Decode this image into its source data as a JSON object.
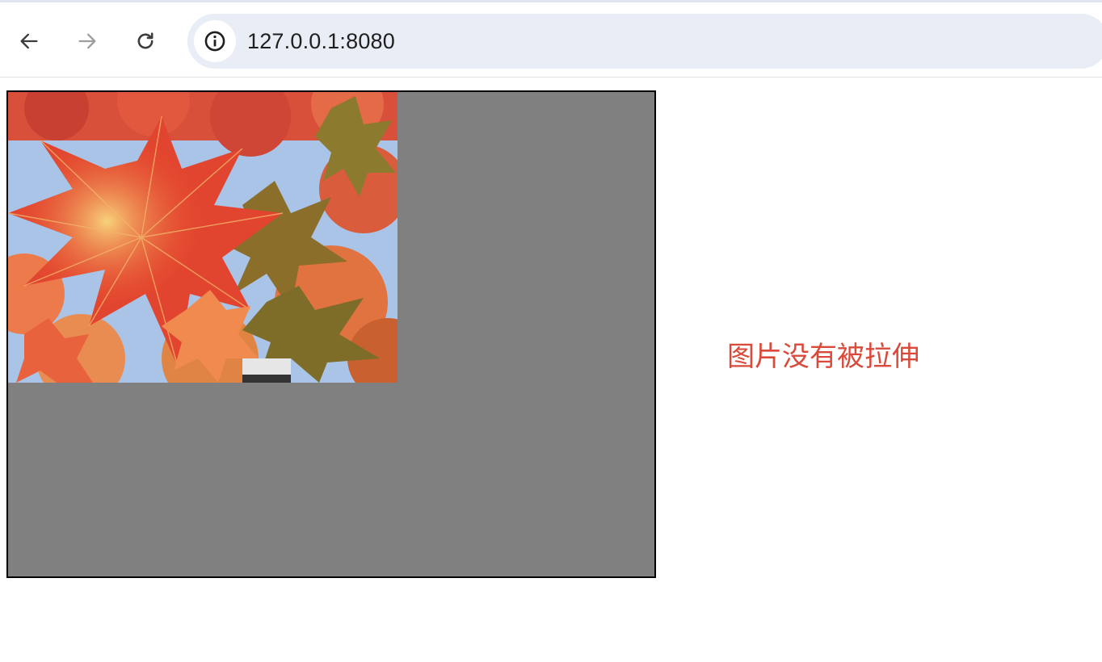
{
  "browser": {
    "url": "127.0.0.1:8080",
    "back_icon": "arrow-left-icon",
    "forward_icon": "arrow-right-icon",
    "reload_icon": "reload-icon",
    "site_info_icon": "info-icon"
  },
  "page": {
    "image_subject": "red and orange maple leaves against blue sky",
    "frame_background": "#808080",
    "caption": "图片没有被拉伸",
    "caption_color": "#d94a3a"
  }
}
